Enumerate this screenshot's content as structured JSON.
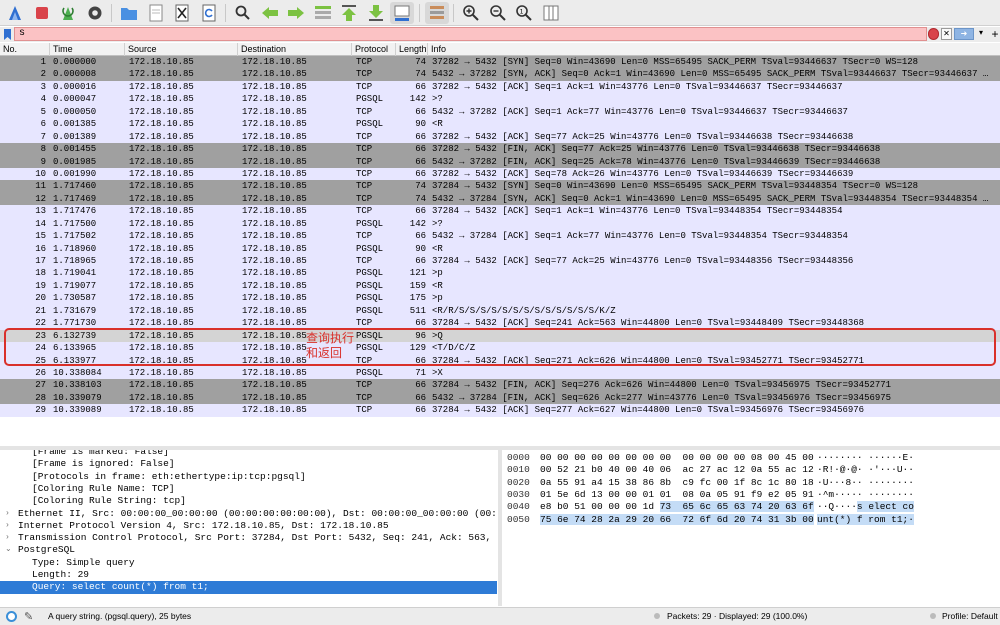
{
  "toolbar": {
    "icons": [
      "shark-fin-start-icon",
      "stop-square-icon",
      "restart-capture-icon",
      "capture-options-gear-icon",
      "open-folder-icon",
      "save-file-icon",
      "close-file-icon",
      "reload-file-icon",
      "find-packet-icon",
      "go-back-icon",
      "go-forward-icon",
      "go-to-packet-icon",
      "go-first-icon",
      "go-last-icon",
      "auto-scroll-icon",
      "colorize-icon",
      "zoom-in-icon",
      "zoom-out-icon",
      "normal-size-icon",
      "resize-columns-icon"
    ]
  },
  "filter": {
    "value": "s",
    "bg_color": "#fbc2c4",
    "plus_label": "+"
  },
  "columns": {
    "no": "No.",
    "time": "Time",
    "source": "Source",
    "destination": "Destination",
    "protocol": "Protocol",
    "length": "Length",
    "info": "Info"
  },
  "colors": {
    "tcp_bg": "#e7e6ff",
    "sync_fin_bg": "#a0a0a0",
    "pgsql_bg": "#e7e6ff",
    "selected_bg": "#d4d4d4",
    "annotation": "#d9302a"
  },
  "packets": [
    {
      "no": "1",
      "time": "0.000000",
      "src": "172.18.10.85",
      "dst": "172.18.10.85",
      "proto": "TCP",
      "len": "74",
      "info": "37282 → 5432 [SYN] Seq=0 Win=43690 Len=0 MSS=65495 SACK_PERM TSval=93446637 TSecr=0 WS=128",
      "kind": "dark"
    },
    {
      "no": "2",
      "time": "0.000008",
      "src": "172.18.10.85",
      "dst": "172.18.10.85",
      "proto": "TCP",
      "len": "74",
      "info": "5432 → 37282 [SYN, ACK] Seq=0 Ack=1 Win=43690 Len=0 MSS=65495 SACK_PERM TSval=93446637 TSecr=93446637 …",
      "kind": "dark"
    },
    {
      "no": "3",
      "time": "0.000016",
      "src": "172.18.10.85",
      "dst": "172.18.10.85",
      "proto": "TCP",
      "len": "66",
      "info": "37282 → 5432 [ACK] Seq=1 Ack=1 Win=43776 Len=0 TSval=93446637 TSecr=93446637",
      "kind": "light"
    },
    {
      "no": "4",
      "time": "0.000047",
      "src": "172.18.10.85",
      "dst": "172.18.10.85",
      "proto": "PGSQL",
      "len": "142",
      "info": ">?",
      "kind": "light"
    },
    {
      "no": "5",
      "time": "0.000050",
      "src": "172.18.10.85",
      "dst": "172.18.10.85",
      "proto": "TCP",
      "len": "66",
      "info": "5432 → 37282 [ACK] Seq=1 Ack=77 Win=43776 Len=0 TSval=93446637 TSecr=93446637",
      "kind": "light"
    },
    {
      "no": "6",
      "time": "0.001385",
      "src": "172.18.10.85",
      "dst": "172.18.10.85",
      "proto": "PGSQL",
      "len": "90",
      "info": "<R",
      "kind": "light"
    },
    {
      "no": "7",
      "time": "0.001389",
      "src": "172.18.10.85",
      "dst": "172.18.10.85",
      "proto": "TCP",
      "len": "66",
      "info": "37282 → 5432 [ACK] Seq=77 Ack=25 Win=43776 Len=0 TSval=93446638 TSecr=93446638",
      "kind": "light"
    },
    {
      "no": "8",
      "time": "0.001455",
      "src": "172.18.10.85",
      "dst": "172.18.10.85",
      "proto": "TCP",
      "len": "66",
      "info": "37282 → 5432 [FIN, ACK] Seq=77 Ack=25 Win=43776 Len=0 TSval=93446638 TSecr=93446638",
      "kind": "dark"
    },
    {
      "no": "9",
      "time": "0.001985",
      "src": "172.18.10.85",
      "dst": "172.18.10.85",
      "proto": "TCP",
      "len": "66",
      "info": "5432 → 37282 [FIN, ACK] Seq=25 Ack=78 Win=43776 Len=0 TSval=93446639 TSecr=93446638",
      "kind": "dark"
    },
    {
      "no": "10",
      "time": "0.001990",
      "src": "172.18.10.85",
      "dst": "172.18.10.85",
      "proto": "TCP",
      "len": "66",
      "info": "37282 → 5432 [ACK] Seq=78 Ack=26 Win=43776 Len=0 TSval=93446639 TSecr=93446639",
      "kind": "light"
    },
    {
      "no": "11",
      "time": "1.717460",
      "src": "172.18.10.85",
      "dst": "172.18.10.85",
      "proto": "TCP",
      "len": "74",
      "info": "37284 → 5432 [SYN] Seq=0 Win=43690 Len=0 MSS=65495 SACK_PERM TSval=93448354 TSecr=0 WS=128",
      "kind": "dark"
    },
    {
      "no": "12",
      "time": "1.717469",
      "src": "172.18.10.85",
      "dst": "172.18.10.85",
      "proto": "TCP",
      "len": "74",
      "info": "5432 → 37284 [SYN, ACK] Seq=0 Ack=1 Win=43690 Len=0 MSS=65495 SACK_PERM TSval=93448354 TSecr=93448354 …",
      "kind": "dark"
    },
    {
      "no": "13",
      "time": "1.717476",
      "src": "172.18.10.85",
      "dst": "172.18.10.85",
      "proto": "TCP",
      "len": "66",
      "info": "37284 → 5432 [ACK] Seq=1 Ack=1 Win=43776 Len=0 TSval=93448354 TSecr=93448354",
      "kind": "light"
    },
    {
      "no": "14",
      "time": "1.717500",
      "src": "172.18.10.85",
      "dst": "172.18.10.85",
      "proto": "PGSQL",
      "len": "142",
      "info": ">?",
      "kind": "light"
    },
    {
      "no": "15",
      "time": "1.717502",
      "src": "172.18.10.85",
      "dst": "172.18.10.85",
      "proto": "TCP",
      "len": "66",
      "info": "5432 → 37284 [ACK] Seq=1 Ack=77 Win=43776 Len=0 TSval=93448354 TSecr=93448354",
      "kind": "light"
    },
    {
      "no": "16",
      "time": "1.718960",
      "src": "172.18.10.85",
      "dst": "172.18.10.85",
      "proto": "PGSQL",
      "len": "90",
      "info": "<R",
      "kind": "light"
    },
    {
      "no": "17",
      "time": "1.718965",
      "src": "172.18.10.85",
      "dst": "172.18.10.85",
      "proto": "TCP",
      "len": "66",
      "info": "37284 → 5432 [ACK] Seq=77 Ack=25 Win=43776 Len=0 TSval=93448356 TSecr=93448356",
      "kind": "light"
    },
    {
      "no": "18",
      "time": "1.719041",
      "src": "172.18.10.85",
      "dst": "172.18.10.85",
      "proto": "PGSQL",
      "len": "121",
      "info": ">p",
      "kind": "light"
    },
    {
      "no": "19",
      "time": "1.719077",
      "src": "172.18.10.85",
      "dst": "172.18.10.85",
      "proto": "PGSQL",
      "len": "159",
      "info": "<R",
      "kind": "light"
    },
    {
      "no": "20",
      "time": "1.730587",
      "src": "172.18.10.85",
      "dst": "172.18.10.85",
      "proto": "PGSQL",
      "len": "175",
      "info": ">p",
      "kind": "light"
    },
    {
      "no": "21",
      "time": "1.731679",
      "src": "172.18.10.85",
      "dst": "172.18.10.85",
      "proto": "PGSQL",
      "len": "511",
      "info": "<R/R/S/S/S/S/S/S/S/S/S/S/S/S/S/K/Z",
      "kind": "light"
    },
    {
      "no": "22",
      "time": "1.771730",
      "src": "172.18.10.85",
      "dst": "172.18.10.85",
      "proto": "TCP",
      "len": "66",
      "info": "37284 → 5432 [ACK] Seq=241 Ack=563 Win=44800 Len=0 TSval=93448409 TSecr=93448368",
      "kind": "light"
    },
    {
      "no": "23",
      "time": "6.132739",
      "src": "172.18.10.85",
      "dst": "172.18.10.85",
      "proto": "PGSQL",
      "len": "96",
      "info": ">Q",
      "kind": "selected"
    },
    {
      "no": "24",
      "time": "6.133965",
      "src": "172.18.10.85",
      "dst": "172.18.10.85",
      "proto": "PGSQL",
      "len": "129",
      "info": "<T/D/C/Z",
      "kind": "light"
    },
    {
      "no": "25",
      "time": "6.133977",
      "src": "172.18.10.85",
      "dst": "172.18.10.85",
      "proto": "TCP",
      "len": "66",
      "info": "37284 → 5432 [ACK] Seq=271 Ack=626 Win=44800 Len=0 TSval=93452771 TSecr=93452771",
      "kind": "light"
    },
    {
      "no": "26",
      "time": "10.338084",
      "src": "172.18.10.85",
      "dst": "172.18.10.85",
      "proto": "PGSQL",
      "len": "71",
      "info": ">X",
      "kind": "light"
    },
    {
      "no": "27",
      "time": "10.338103",
      "src": "172.18.10.85",
      "dst": "172.18.10.85",
      "proto": "TCP",
      "len": "66",
      "info": "37284 → 5432 [FIN, ACK] Seq=276 Ack=626 Win=44800 Len=0 TSval=93456975 TSecr=93452771",
      "kind": "dark"
    },
    {
      "no": "28",
      "time": "10.339079",
      "src": "172.18.10.85",
      "dst": "172.18.10.85",
      "proto": "TCP",
      "len": "66",
      "info": "5432 → 37284 [FIN, ACK] Seq=626 Ack=277 Win=43776 Len=0 TSval=93456976 TSecr=93456975",
      "kind": "dark"
    },
    {
      "no": "29",
      "time": "10.339089",
      "src": "172.18.10.85",
      "dst": "172.18.10.85",
      "proto": "TCP",
      "len": "66",
      "info": "37284 → 5432 [ACK] Seq=277 Ack=627 Win=44800 Len=0 TSval=93456976 TSecr=93456976",
      "kind": "light"
    }
  ],
  "annotation": {
    "text": "查询执行和返回"
  },
  "details": [
    {
      "text": "[Frame is marked: False]",
      "indent": 32,
      "arrow": "",
      "selected": false
    },
    {
      "text": "[Frame is ignored: False]",
      "indent": 32,
      "arrow": "",
      "selected": false
    },
    {
      "text": "[Protocols in frame: eth:ethertype:ip:tcp:pgsql]",
      "indent": 32,
      "arrow": "",
      "selected": false
    },
    {
      "text": "[Coloring Rule Name: TCP]",
      "indent": 32,
      "arrow": "",
      "selected": false
    },
    {
      "text": "[Coloring Rule String: tcp]",
      "indent": 32,
      "arrow": "",
      "selected": false
    },
    {
      "text": "Ethernet II, Src: 00:00:00_00:00:00 (00:00:00:00:00:00), Dst: 00:00:00_00:00:00 (00:00:0",
      "indent": 18,
      "arrow": "›",
      "selected": false
    },
    {
      "text": "Internet Protocol Version 4, Src: 172.18.10.85, Dst: 172.18.10.85",
      "indent": 18,
      "arrow": "›",
      "selected": false
    },
    {
      "text": "Transmission Control Protocol, Src Port: 37284, Dst Port: 5432, Seq: 241, Ack: 563, Len:",
      "indent": 18,
      "arrow": "›",
      "selected": false
    },
    {
      "text": "PostgreSQL",
      "indent": 18,
      "arrow": "⌄",
      "selected": false
    },
    {
      "text": "Type: Simple query",
      "indent": 32,
      "arrow": "",
      "selected": false
    },
    {
      "text": "Length: 29",
      "indent": 32,
      "arrow": "",
      "selected": false
    },
    {
      "text": "Query: select count(*) from t1;",
      "indent": 32,
      "arrow": "",
      "selected": true
    }
  ],
  "hex": [
    {
      "off": "0000",
      "pre": "00 00 00 00 00 00 00 00  00 00 00 00 08 00 45 00",
      "hi": "",
      "ascii_pre": "········ ······E·",
      "ascii_hi": ""
    },
    {
      "off": "0010",
      "pre": "00 52 21 b0 40 00 40 06  ac 27 ac 12 0a 55 ac 12",
      "hi": "",
      "ascii_pre": "·R!·@·@· ·'···U··",
      "ascii_hi": ""
    },
    {
      "off": "0020",
      "pre": "0a 55 91 a4 15 38 86 8b  c9 fc 00 1f 8c 1c 80 18",
      "hi": "",
      "ascii_pre": "·U···8·· ········",
      "ascii_hi": ""
    },
    {
      "off": "0030",
      "pre": "01 5e 6d 13 00 00 01 01  08 0a 05 91 f9 e2 05 91",
      "hi": "",
      "ascii_pre": "·^m····· ········",
      "ascii_hi": ""
    },
    {
      "off": "0040",
      "pre": "e8 b0 51 00 00 00 1d ",
      "hi": "73  65 6c 65 63 74 20 63 6f",
      "ascii_pre": "··Q····",
      "ascii_hi": "s elect co"
    },
    {
      "off": "0050",
      "pre": "",
      "hi": "75 6e 74 28 2a 29 20 66  72 6f 6d 20 74 31 3b 00",
      "ascii_pre": "",
      "ascii_hi": "unt(*) f rom t1;·"
    }
  ],
  "status": {
    "message": "A query string. (pgsql.query), 25 bytes",
    "packets": "Packets: 29 · Displayed: 29 (100.0%)",
    "profile": "Profile: Default"
  }
}
